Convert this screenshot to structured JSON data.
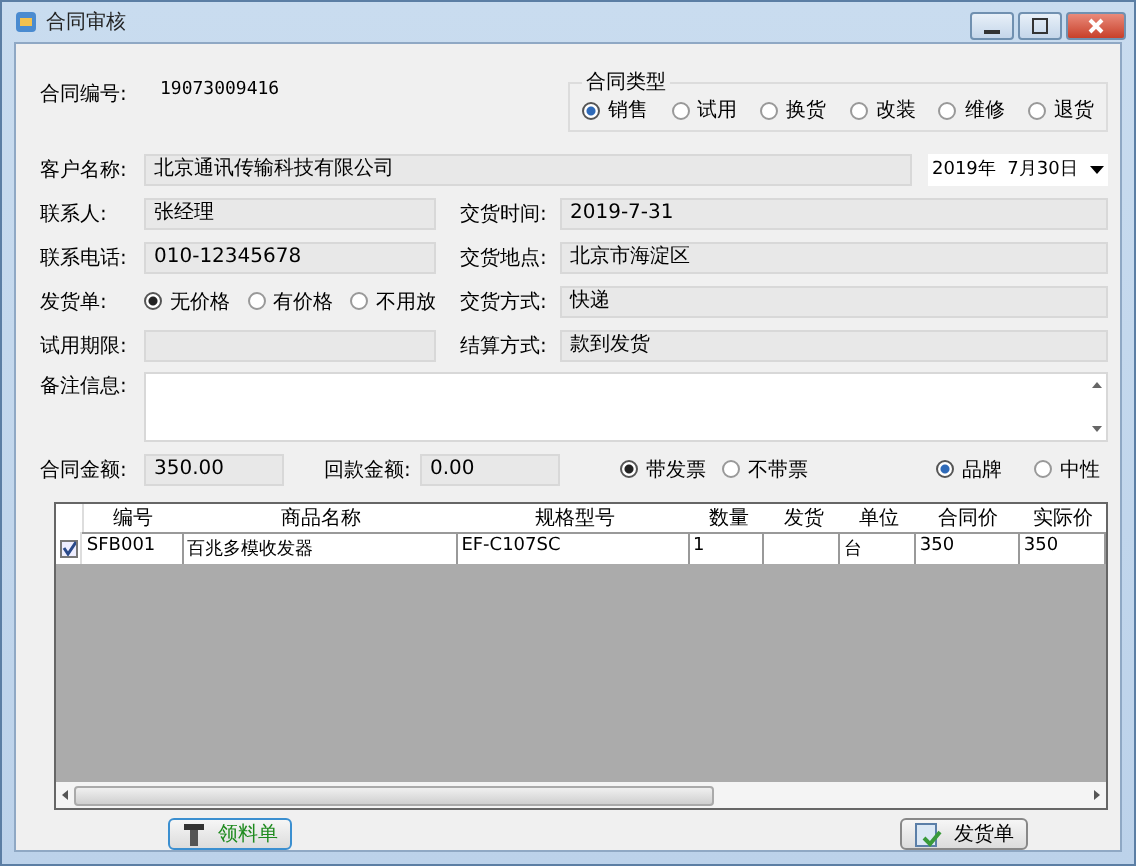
{
  "window": {
    "title": "合同审核"
  },
  "contract_no": {
    "label": "合同编号:",
    "value": "19073009416"
  },
  "contract_type": {
    "title": "合同类型",
    "options": [
      {
        "label": "销售",
        "selected": true
      },
      {
        "label": "试用",
        "selected": false
      },
      {
        "label": "换货",
        "selected": false
      },
      {
        "label": "改装",
        "selected": false
      },
      {
        "label": "维修",
        "selected": false
      },
      {
        "label": "退货",
        "selected": false
      }
    ]
  },
  "customer": {
    "label": "客户名称:",
    "value": "北京通讯传输科技有限公司"
  },
  "date": {
    "value": "2019年  7月30日"
  },
  "contact": {
    "label": "联系人:",
    "value": "张经理"
  },
  "delivery_time": {
    "label": "交货时间:",
    "value": "2019-7-31"
  },
  "phone": {
    "label": "联系电话:",
    "value": "010-12345678"
  },
  "delivery_place": {
    "label": "交货地点:",
    "value": "北京市海淀区"
  },
  "delivery_note": {
    "label": "发货单:",
    "options": [
      {
        "label": "无价格",
        "selected": true
      },
      {
        "label": "有价格",
        "selected": false
      },
      {
        "label": "不用放",
        "selected": false
      }
    ]
  },
  "delivery_method": {
    "label": "交货方式:",
    "value": "快递"
  },
  "trial_period": {
    "label": "试用期限:"
  },
  "settlement": {
    "label": "结算方式:",
    "value": "款到发货"
  },
  "remarks": {
    "label": "备注信息:"
  },
  "contract_amount": {
    "label": "合同金额:",
    "value": "350.00"
  },
  "received_amount": {
    "label": "回款金额:",
    "value": "0.00"
  },
  "invoice": {
    "options": [
      {
        "label": "带发票",
        "selected": true
      },
      {
        "label": "不带票",
        "selected": false
      }
    ]
  },
  "brand": {
    "options": [
      {
        "label": "品牌",
        "selected": true
      },
      {
        "label": "中性",
        "selected": false
      }
    ]
  },
  "table": {
    "columns": [
      "编号",
      "商品名称",
      "规格型号",
      "数量",
      "发货",
      "单位",
      "合同价",
      "实际价"
    ],
    "rows": [
      {
        "checked": true,
        "cells": [
          "SFB001",
          "百兆多模收发器",
          "EF-C107SC",
          "1",
          "",
          "台",
          "350",
          "350"
        ]
      }
    ]
  },
  "buttons": [
    {
      "label": "领料单",
      "kind": "materials"
    },
    {
      "label": "发货单",
      "kind": "shipping"
    }
  ]
}
